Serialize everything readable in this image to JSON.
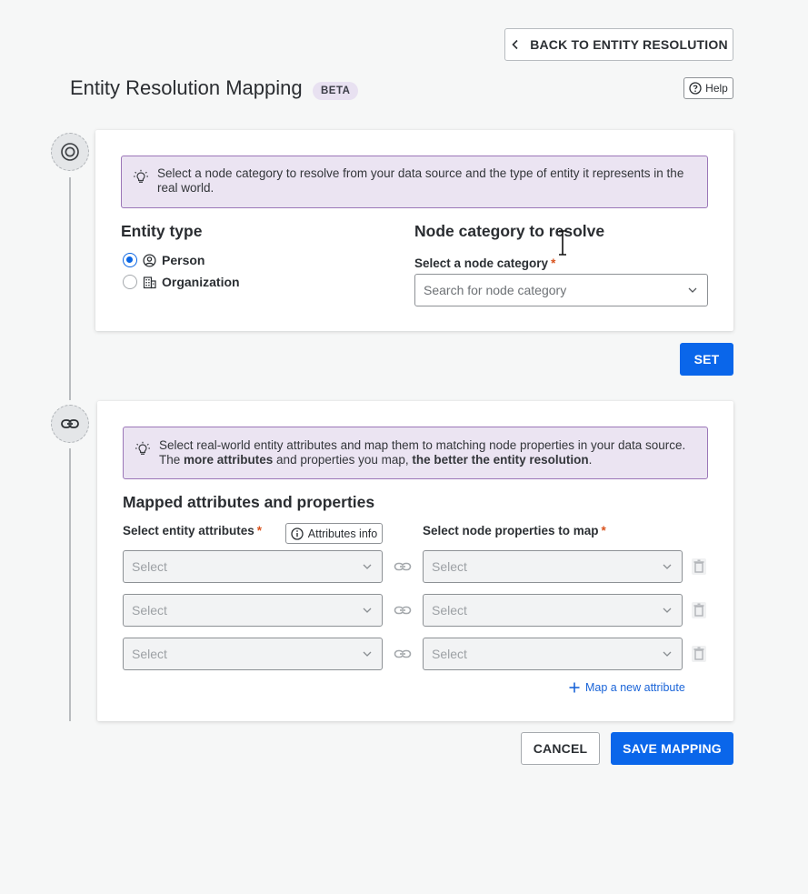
{
  "header": {
    "back_label": "BACK TO ENTITY RESOLUTION",
    "title": "Entity Resolution Mapping",
    "badge": "BETA",
    "help_label": "Help"
  },
  "step1": {
    "icon": "target-icon",
    "info_text": "Select a node category to resolve from your data source and the type of entity it represents in the real world.",
    "entity_type": {
      "heading": "Entity type",
      "options": [
        {
          "label": "Person",
          "icon": "person-circle-icon",
          "selected": true
        },
        {
          "label": "Organization",
          "icon": "building-icon",
          "selected": false
        }
      ]
    },
    "node_category": {
      "heading": "Node category to resolve",
      "label": "Select a node category",
      "required_mark": "*",
      "placeholder": "Search for node category"
    },
    "set_label": "SET"
  },
  "step2": {
    "icon": "link-icon",
    "info_prefix": "Select real-world entity attributes and map them to matching node properties in your data source. The ",
    "info_bold1": "more attributes",
    "info_mid": " and properties you map, ",
    "info_bold2": "the better the entity resolution",
    "info_suffix": ".",
    "heading": "Mapped attributes and properties",
    "attr_label": "Select entity attributes",
    "attr_info_label": "Attributes info",
    "prop_label": "Select node properties to map",
    "required_mark": "*",
    "rows": [
      {
        "attribute": "Select",
        "property": "Select"
      },
      {
        "attribute": "Select",
        "property": "Select"
      },
      {
        "attribute": "Select",
        "property": "Select"
      }
    ],
    "map_new_label": "Map a new attribute"
  },
  "footer": {
    "cancel_label": "CANCEL",
    "save_label": "SAVE MAPPING"
  },
  "colors": {
    "primary": "#0a66ea",
    "info_bg": "#ebe4f2",
    "info_border": "#9b76b8",
    "required": "#d9531e"
  }
}
